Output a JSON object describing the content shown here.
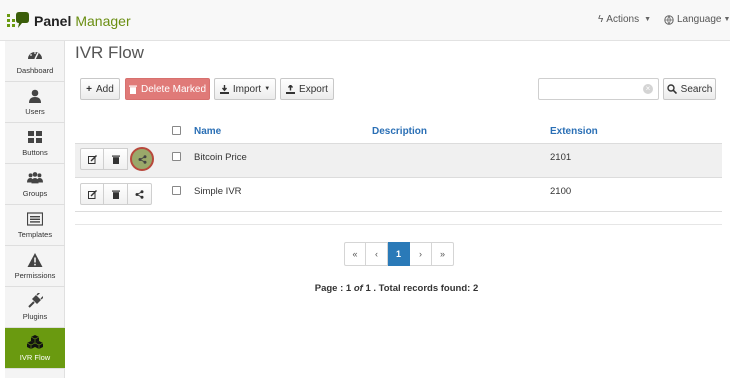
{
  "app": {
    "brand_bold": "Panel",
    "brand_light": "Manager"
  },
  "topnav": {
    "actions_label": "Actions",
    "language_label": "Language"
  },
  "sidebar": {
    "items": [
      {
        "label": "Dashboard",
        "icon": "dashboard-icon"
      },
      {
        "label": "Users",
        "icon": "user-icon"
      },
      {
        "label": "Buttons",
        "icon": "grid-icon"
      },
      {
        "label": "Groups",
        "icon": "group-icon"
      },
      {
        "label": "Templates",
        "icon": "list-icon"
      },
      {
        "label": "Permissions",
        "icon": "warning-icon"
      },
      {
        "label": "Plugins",
        "icon": "plug-icon"
      },
      {
        "label": "IVR Flow",
        "icon": "cubes-icon",
        "active": true
      }
    ]
  },
  "page": {
    "title": "IVR Flow"
  },
  "toolbar": {
    "add_label": "Add",
    "delete_label": "Delete Marked",
    "import_label": "Import",
    "export_label": "Export",
    "search_label": "Search",
    "search_value": ""
  },
  "table": {
    "headers": {
      "name": "Name",
      "description": "Description",
      "extension": "Extension"
    },
    "rows": [
      {
        "name": "Bitcoin Price",
        "description": "",
        "extension": "2101"
      },
      {
        "name": "Simple IVR",
        "description": "",
        "extension": "2100"
      }
    ]
  },
  "pagination": {
    "first": "«",
    "prev": "‹",
    "current": "1",
    "next": "›",
    "last": "»",
    "info_prefix": "Page : ",
    "page": "1",
    "of_word": "of",
    "total_pages": "1",
    "info_suffix": " . Total records found: ",
    "total_records": "2"
  },
  "colors": {
    "accent": "#6a9a10",
    "link": "#2a6fb5",
    "danger": "#e07a78",
    "pager_active": "#2a7ab8"
  }
}
